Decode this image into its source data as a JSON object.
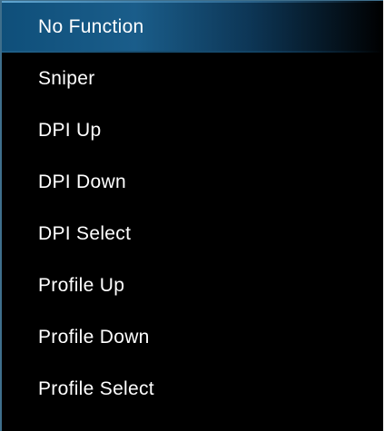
{
  "menu": {
    "items": [
      {
        "label": "No Function"
      },
      {
        "label": "Sniper"
      },
      {
        "label": "DPI Up"
      },
      {
        "label": "DPI Down"
      },
      {
        "label": "DPI Select"
      },
      {
        "label": "Profile Up"
      },
      {
        "label": "Profile Down"
      },
      {
        "label": "Profile Select"
      }
    ],
    "selected_index": 0
  },
  "colors": {
    "background": "#000000",
    "text": "#ffffff",
    "highlight": "#1a5d8a",
    "border": "#3f6f8c"
  }
}
